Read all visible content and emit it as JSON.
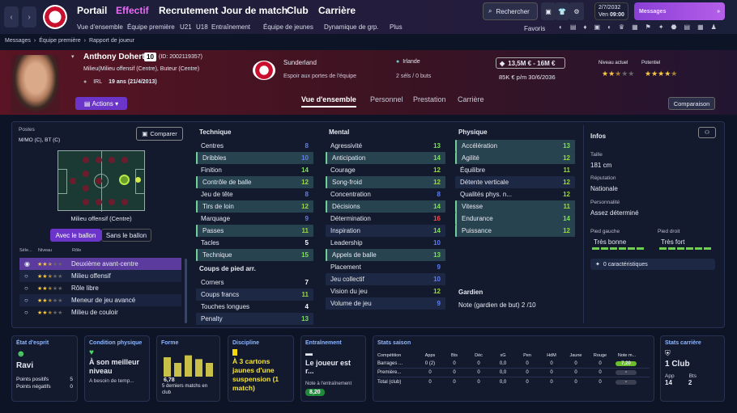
{
  "nav": {
    "menus": [
      "Portail",
      "Effectif",
      "Recrutement",
      "Jour de match",
      "Club",
      "Carrière"
    ],
    "active": "Effectif",
    "submenus": [
      "Vue d'ensemble",
      "Équipe première",
      "U21",
      "U18",
      "Entraînement",
      "Équipe de jeunes",
      "Dynamique de grp.",
      "Plus"
    ],
    "search": "Rechercher",
    "date": "2/7/2032",
    "day": "Ven",
    "time": "09:00",
    "messages": "Messages",
    "favoris": "Favoris"
  },
  "breadcrumb": [
    "Messages",
    "Équipe première",
    "Rapport de joueur"
  ],
  "player": {
    "name": "Anthony Doherty",
    "number": "10",
    "id": "(ID: 2002119357)",
    "positions": "Milieu(Milieu offensif (Centre), Buteur (Centre)",
    "nation": "IRL",
    "age": "19 ans (21/4/2013)",
    "club": "Sunderland",
    "club_status": "Espoir aux portes de l'équipe",
    "country": "Irlande",
    "caps": "2 séls / 0 buts",
    "value": "13,5M € - 16M €",
    "wage": "85K € p/m 30/6/2036",
    "current_level_label": "Niveau actuel",
    "potential_label": "Potentiel",
    "current_stars": 2.5,
    "potential_stars": 4.5
  },
  "actions": "Actions",
  "tabs": [
    "Vue d'ensemble",
    "Personnel",
    "Prestation",
    "Carrière"
  ],
  "compare_btn": "Comparaison",
  "left": {
    "postes_label": "Postes",
    "postes": "M/MO (C), BT (C)",
    "compare": "Comparer",
    "role_label": "Milieu offensif (Centre)",
    "with_ball": "Avec le ballon",
    "without_ball": "Sans le ballon",
    "col_sel": "Séle...",
    "col_level": "Niveau",
    "col_role": "Rôle",
    "roles": [
      {
        "name": "Deuxième avant-centre",
        "stars": 2.5,
        "sel": true
      },
      {
        "name": "Milieu offensif",
        "stars": 2.5
      },
      {
        "name": "Rôle libre",
        "stars": 2.5
      },
      {
        "name": "Meneur de jeu avancé",
        "stars": 2.5
      },
      {
        "name": "Milieu de couloir",
        "stars": 2.5
      }
    ]
  },
  "attributes": {
    "technique_label": "Technique",
    "mental_label": "Mental",
    "physique_label": "Physique",
    "setpieces_label": "Coups de pied arr.",
    "goalkeeper_label": "Gardien",
    "technique": [
      [
        "Centres",
        "8"
      ],
      [
        "Dribbles",
        "10"
      ],
      [
        "Finition",
        "14"
      ],
      [
        "Contrôle de balle",
        "12"
      ],
      [
        "Jeu de tête",
        "8"
      ],
      [
        "Tirs de loin",
        "12"
      ],
      [
        "Marquage",
        "9"
      ],
      [
        "Passes",
        "11"
      ],
      [
        "Tacles",
        "5"
      ],
      [
        "Technique",
        "15"
      ]
    ],
    "setpieces": [
      [
        "Corners",
        "7"
      ],
      [
        "Coups francs",
        "11"
      ],
      [
        "Touches longues",
        "4"
      ],
      [
        "Penalty",
        "13"
      ]
    ],
    "mental": [
      [
        "Agressivité",
        "13"
      ],
      [
        "Anticipation",
        "14"
      ],
      [
        "Courage",
        "12"
      ],
      [
        "Song-froid",
        "12"
      ],
      [
        "Concentration",
        "8"
      ],
      [
        "Décisions",
        "14"
      ],
      [
        "Détermination",
        "16"
      ],
      [
        "Inspiration",
        "14"
      ],
      [
        "Leadership",
        "10"
      ],
      [
        "Appels de balle",
        "13"
      ],
      [
        "Placement",
        "9"
      ],
      [
        "Jeu collectif",
        "10"
      ],
      [
        "Vision du jeu",
        "12"
      ],
      [
        "Volume de jeu",
        "9"
      ]
    ],
    "physique": [
      [
        "Accélération",
        "13"
      ],
      [
        "Agilité",
        "12"
      ],
      [
        "Équilibre",
        "11"
      ],
      [
        "Détente verticale",
        "12"
      ],
      [
        "Qualités phys. n...",
        "12"
      ],
      [
        "Vitesse",
        "11"
      ],
      [
        "Endurance",
        "14"
      ],
      [
        "Puissance",
        "12"
      ]
    ],
    "goalkeeper": "Note (gardien de but) 2 /10"
  },
  "info": {
    "title": "Infos",
    "height_label": "Taille",
    "height": "181 cm",
    "rep_label": "Réputation",
    "rep": "Nationale",
    "pers_label": "Personnalité",
    "pers": "Assez déterminé",
    "lf_label": "Pied gauche",
    "lf": "Très bonne",
    "rf_label": "Pied droit",
    "rf": "Très fort",
    "traits": "0 caractéristiques"
  },
  "cards": {
    "mood_t": "État d'esprit",
    "mood": "Ravi",
    "pp_label": "Points positifs",
    "pp": "5",
    "pn_label": "Points négatifs",
    "pn": "0",
    "cond_t": "Condition physique",
    "cond": "À son meilleur niveau",
    "cond_sub": "A besoin de temp...",
    "form_t": "Forme",
    "form_avg": "6,78",
    "form_sub": "5 derniers matchs en club",
    "form_values": [
      6.9,
      6.6,
      7.0,
      6.8,
      6.6
    ],
    "disc_t": "Discipline",
    "disc": "À 3 cartons jaunes d'une suspension (1 match)",
    "train_t": "Entraînement",
    "train": "Le joueur est r...",
    "train_note_label": "Note à l'entraînement",
    "train_note": "8,20",
    "season_t": "Stats saison",
    "season_cols": [
      "Compétition",
      "Apps",
      "Bts",
      "Déc",
      "xG",
      "Pen",
      "HdM",
      "Jaune",
      "Rouge",
      "Note m..."
    ],
    "season_rows": [
      [
        "Barrages ...",
        "0 (2)",
        "0",
        "0",
        "0,0",
        "0",
        "0",
        "0",
        "0",
        "7,20"
      ],
      [
        "Première...",
        "0",
        "0",
        "0",
        "0,0",
        "0",
        "0",
        "0",
        "0",
        "-"
      ],
      [
        "Total (club)",
        "0",
        "0",
        "0",
        "0,0",
        "0",
        "0",
        "0",
        "0",
        "-"
      ]
    ],
    "career_t": "Stats carrière",
    "career": "1 Club",
    "app_label": "App",
    "app": "14",
    "bts_label": "Bts",
    "bts": "2"
  }
}
